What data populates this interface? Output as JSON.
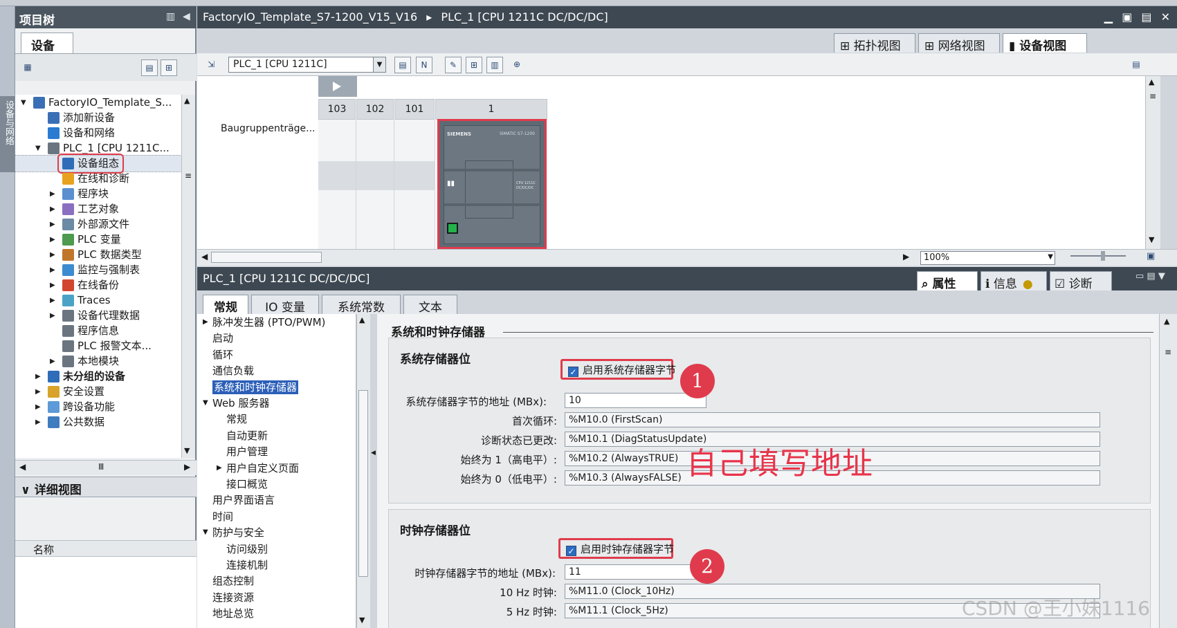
{
  "left_tab": "设备与网络",
  "project_tree": {
    "title": "项目树",
    "tab": "设备",
    "items": [
      {
        "label": "FactoryIO_Template_S...",
        "depth": 0,
        "arrow": "▼",
        "bold": false
      },
      {
        "label": "添加新设备",
        "depth": 1,
        "arrow": "",
        "bold": false
      },
      {
        "label": "设备和网络",
        "depth": 1,
        "arrow": "",
        "bold": false
      },
      {
        "label": "PLC_1 [CPU 1211C...",
        "depth": 1,
        "arrow": "▼",
        "bold": false
      },
      {
        "label": "设备组态",
        "depth": 2,
        "arrow": "",
        "bold": false,
        "highlight": true
      },
      {
        "label": "在线和诊断",
        "depth": 2,
        "arrow": "",
        "bold": false
      },
      {
        "label": "程序块",
        "depth": 2,
        "arrow": "▶",
        "bold": false
      },
      {
        "label": "工艺对象",
        "depth": 2,
        "arrow": "▶",
        "bold": false
      },
      {
        "label": "外部源文件",
        "depth": 2,
        "arrow": "▶",
        "bold": false
      },
      {
        "label": "PLC 变量",
        "depth": 2,
        "arrow": "▶",
        "bold": false
      },
      {
        "label": "PLC 数据类型",
        "depth": 2,
        "arrow": "▶",
        "bold": false
      },
      {
        "label": "监控与强制表",
        "depth": 2,
        "arrow": "▶",
        "bold": false
      },
      {
        "label": "在线备份",
        "depth": 2,
        "arrow": "▶",
        "bold": false
      },
      {
        "label": "Traces",
        "depth": 2,
        "arrow": "▶",
        "bold": false
      },
      {
        "label": "设备代理数据",
        "depth": 2,
        "arrow": "▶",
        "bold": false
      },
      {
        "label": "程序信息",
        "depth": 2,
        "arrow": "",
        "bold": false
      },
      {
        "label": "PLC 报警文本...",
        "depth": 2,
        "arrow": "",
        "bold": false
      },
      {
        "label": "本地模块",
        "depth": 2,
        "arrow": "▶",
        "bold": false
      },
      {
        "label": "未分组的设备",
        "depth": 1,
        "arrow": "▶",
        "bold": true
      },
      {
        "label": "安全设置",
        "depth": 1,
        "arrow": "▶",
        "bold": false
      },
      {
        "label": "跨设备功能",
        "depth": 1,
        "arrow": "▶",
        "bold": false
      },
      {
        "label": "公共数据",
        "depth": 1,
        "arrow": "▶",
        "bold": false
      }
    ],
    "detail_title": "详细视图",
    "detail_column": "名称"
  },
  "main": {
    "breadcrumb_project": "FactoryIO_Template_S7-1200_V15_V16",
    "breadcrumb_sep": "▸",
    "breadcrumb_device": "PLC_1 [CPU 1211C DC/DC/DC]",
    "view_tabs": [
      "拓扑视图",
      "网络视图",
      "设备视图"
    ],
    "device_select": "PLC_1 [CPU 1211C]",
    "rack_label": "Baugruppenträge...",
    "slots": [
      "103",
      "102",
      "101",
      "1"
    ],
    "cpu_brand": "SIEMENS",
    "cpu_model": "SIMATIC S7-1200",
    "cpu_text": "CPU 1211C DC/DC/DC",
    "zoom": "100%"
  },
  "inspector": {
    "title": "PLC_1 [CPU 1211C DC/DC/DC]",
    "tabs": [
      "属性",
      "信息",
      "诊断"
    ],
    "prop_tabs": [
      "常规",
      "IO 变量",
      "系统常数",
      "文本"
    ],
    "nav": [
      {
        "label": "脉冲发生器 (PTO/PWM)",
        "depth": 0,
        "arrow": "▶"
      },
      {
        "label": "启动",
        "depth": 0,
        "arrow": ""
      },
      {
        "label": "循环",
        "depth": 0,
        "arrow": ""
      },
      {
        "label": "通信负载",
        "depth": 0,
        "arrow": ""
      },
      {
        "label": "系统和时钟存储器",
        "depth": 0,
        "arrow": "",
        "selected": true
      },
      {
        "label": "Web 服务器",
        "depth": 0,
        "arrow": "▼"
      },
      {
        "label": "常规",
        "depth": 1,
        "arrow": ""
      },
      {
        "label": "自动更新",
        "depth": 1,
        "arrow": ""
      },
      {
        "label": "用户管理",
        "depth": 1,
        "arrow": ""
      },
      {
        "label": "用户自定义页面",
        "depth": 1,
        "arrow": "▶"
      },
      {
        "label": "接口概览",
        "depth": 1,
        "arrow": ""
      },
      {
        "label": "用户界面语言",
        "depth": 0,
        "arrow": ""
      },
      {
        "label": "时间",
        "depth": 0,
        "arrow": ""
      },
      {
        "label": "防护与安全",
        "depth": 0,
        "arrow": "▼"
      },
      {
        "label": "访问级别",
        "depth": 1,
        "arrow": ""
      },
      {
        "label": "连接机制",
        "depth": 1,
        "arrow": ""
      },
      {
        "label": "组态控制",
        "depth": 0,
        "arrow": ""
      },
      {
        "label": "连接资源",
        "depth": 0,
        "arrow": ""
      },
      {
        "label": "地址总览",
        "depth": 0,
        "arrow": ""
      }
    ],
    "section_title": "系统和时钟存储器",
    "system_group": {
      "title": "系统存储器位",
      "enable_label": "启用系统存储器字节",
      "enabled": true,
      "address_label": "系统存储器字节的地址 (MBx):",
      "address_value": "10",
      "rows": [
        {
          "label": "首次循环:",
          "value": "%M10.0 (FirstScan)"
        },
        {
          "label": "诊断状态已更改:",
          "value": "%M10.1 (DiagStatusUpdate)"
        },
        {
          "label": "始终为 1（高电平）:",
          "value": "%M10.2 (AlwaysTRUE)"
        },
        {
          "label": "始终为 0（低电平）:",
          "value": "%M10.3 (AlwaysFALSE)"
        }
      ]
    },
    "clock_group": {
      "title": "时钟存储器位",
      "enable_label": "启用时钟存储器字节",
      "enabled": true,
      "address_label": "时钟存储器字节的地址 (MBx):",
      "address_value": "11",
      "rows": [
        {
          "label": "10 Hz 时钟:",
          "value": "%M11.0 (Clock_10Hz)"
        },
        {
          "label": "5 Hz 时钟:",
          "value": "%M11.1 (Clock_5Hz)"
        }
      ]
    }
  },
  "annotations": {
    "badge1": "1",
    "badge2": "2",
    "note": "自己填写地址",
    "watermark": "CSDN @王小妹1116"
  },
  "colors": {
    "accent_red": "#e03b4c",
    "header_dark": "#3e4852",
    "selection_blue": "#2b5fb8"
  }
}
